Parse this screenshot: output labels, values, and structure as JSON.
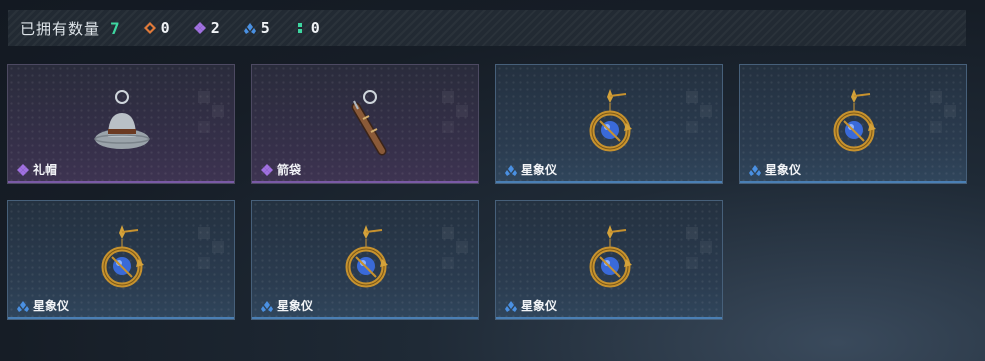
{
  "summary": {
    "label": "已拥有数量",
    "total": "7",
    "counters": [
      {
        "icon": "orange-gem-icon",
        "color": "#e07a3a",
        "value": "0"
      },
      {
        "icon": "purple-gem-icon",
        "color": "#a070e0",
        "value": "2"
      },
      {
        "icon": "blue-gem-icon",
        "color": "#4a90e2",
        "value": "5"
      },
      {
        "icon": "green-dots-icon",
        "color": "#3ed6a0",
        "value": "0"
      }
    ]
  },
  "items": [
    {
      "name": "礼帽",
      "rarity": "epic",
      "art": "top-hat"
    },
    {
      "name": "箭袋",
      "rarity": "epic",
      "art": "quiver"
    },
    {
      "name": "星象仪",
      "rarity": "rare",
      "art": "astrolabe"
    },
    {
      "name": "星象仪",
      "rarity": "rare",
      "art": "astrolabe"
    },
    {
      "name": "星象仪",
      "rarity": "rare",
      "art": "astrolabe"
    },
    {
      "name": "星象仪",
      "rarity": "rare",
      "art": "astrolabe"
    },
    {
      "name": "星象仪",
      "rarity": "rare",
      "art": "astrolabe"
    }
  ]
}
